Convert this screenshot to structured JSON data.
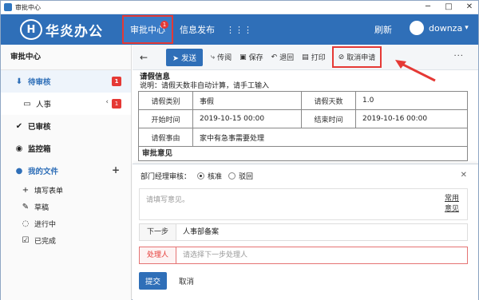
{
  "window": {
    "title": "审批中心"
  },
  "header": {
    "logo_text": "华炎办公",
    "nav": [
      {
        "label": "审批中心",
        "badge": "1"
      },
      {
        "label": "信息发布"
      }
    ],
    "refresh_label": "刷新",
    "user_name": "downza",
    "user_caret": "▾"
  },
  "sidebar": {
    "title": "审批中心",
    "pending": {
      "label": "待审核",
      "badge": "1"
    },
    "personnel": {
      "label": "人事",
      "badge": "1"
    },
    "approved": {
      "label": "已审核"
    },
    "monitor": {
      "label": "监控箱"
    },
    "my_files": {
      "label": "我的文件"
    },
    "sub": [
      "填写表单",
      "草稿",
      "进行中",
      "已完成"
    ]
  },
  "toolbar": {
    "send": "发送",
    "forward": "传阅",
    "save": "保存",
    "return": "退回",
    "print": "打印",
    "cancel_request": "取消申请",
    "more": "···"
  },
  "document": {
    "section_title": "请假信息",
    "note": "说明：请假天数非自动计算，请手工输入",
    "rows": [
      [
        "请假类别",
        "事假",
        "请假天数",
        "1.0"
      ],
      [
        "开始时间",
        "2019-10-15 00:00",
        "结束时间",
        "2019-10-16 00:00"
      ],
      [
        "请假事由",
        "家中有急事需要处理"
      ]
    ],
    "opinion_title": "审批意见"
  },
  "panel": {
    "label": "部门经理审核：",
    "approve": "核准",
    "reject": "驳回",
    "textarea_placeholder": "请填写意见。",
    "common_1": "常用",
    "common_2": "意见",
    "next_step_label": "下一步",
    "next_step_value": "人事部备案",
    "handler_label": "处理人",
    "handler_placeholder": "请选择下一步处理人",
    "submit": "提交",
    "cancel": "取消"
  },
  "colors": {
    "brand": "#2f6fb8",
    "highlight": "#e53935"
  }
}
